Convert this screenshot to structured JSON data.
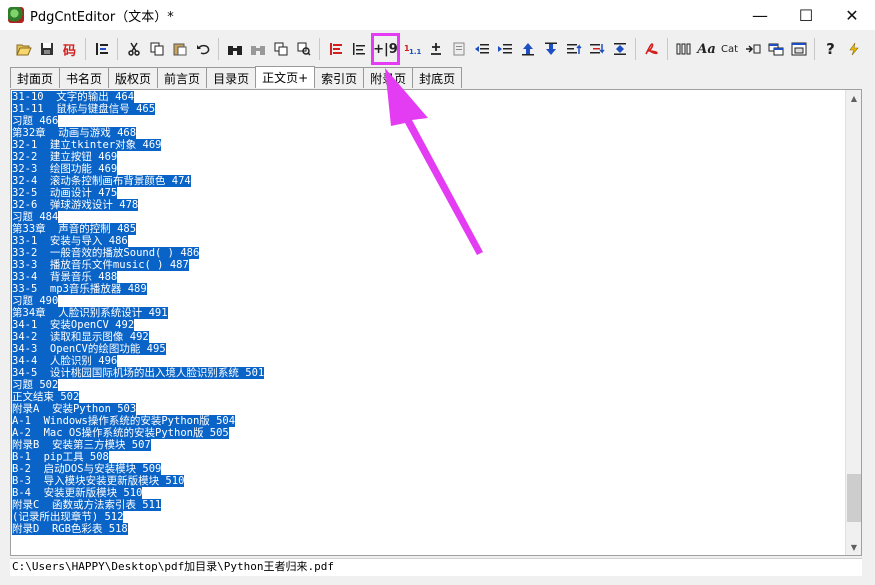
{
  "window": {
    "title": "PdgCntEditor（文本）*",
    "min": "—",
    "max": "☐",
    "close": "✕"
  },
  "toolbar": {
    "icons": [
      "open-icon",
      "save-icon",
      "code-icon",
      "outline-icon",
      "cut-icon",
      "copy-icon",
      "paste-icon",
      "undo-icon",
      "find-icon",
      "find-next-icon",
      "replace-icon",
      "replace-all-icon",
      "align-left-icon",
      "level-icon",
      "add-page-number-icon",
      "renumber-icon",
      "plus-minus-icon",
      "document-icon",
      "indent-decrease-icon",
      "indent-increase-icon",
      "move-up-icon",
      "move-down-icon",
      "promote-icon",
      "demote-icon",
      "merge-icon",
      "pdf-icon",
      "book-icon",
      "font-icon",
      "cat-icon",
      "link-icon",
      "window-icon",
      "split-icon",
      "help-icon",
      "lightning-icon"
    ],
    "code_label": "码",
    "page_number_label": "+|9",
    "font_label": "Aa",
    "cat_label": "Cat",
    "help_label": "?"
  },
  "tabs": [
    {
      "label": "封面页",
      "active": false
    },
    {
      "label": "书名页",
      "active": false
    },
    {
      "label": "版权页",
      "active": false
    },
    {
      "label": "前言页",
      "active": false
    },
    {
      "label": "目录页",
      "active": false
    },
    {
      "label": "正文页+",
      "active": true
    },
    {
      "label": "索引页",
      "active": false
    },
    {
      "label": "附录页",
      "active": false
    },
    {
      "label": "封底页",
      "active": false
    }
  ],
  "editor": {
    "lines": [
      "31-10  文字的输出 464",
      "31-11  鼠标与键盘信号 465",
      "习题 466",
      "第32章  动画与游戏 468",
      "32-1  建立tkinter对象 469",
      "32-2  建立按钮 469",
      "32-3  绘图功能 469",
      "32-4  滚动条控制画布背景颜色 474",
      "32-5  动画设计 475",
      "32-6  弹球游戏设计 478",
      "习题 484",
      "第33章  声音的控制 485",
      "33-1  安装与导入 486",
      "33-2  一般音效的播放Sound( ) 486",
      "33-3  播放音乐文件music( ) 487",
      "33-4  背景音乐 488",
      "33-5  mp3音乐播放器 489",
      "习题 490",
      "第34章  人脸识别系统设计 491",
      "34-1  安装OpenCV 492",
      "34-2  读取和显示图像 492",
      "34-3  OpenCV的绘图功能 495",
      "34-4  人脸识别 496",
      "34-5  设计桃园国际机场的出入境人脸识别系统 501",
      "习题 502",
      "正文结束 502",
      "附录A  安装Python 503",
      "A-1  Windows操作系统的安装Python版 504",
      "A-2  Mac OS操作系统的安装Python版 505",
      "附录B  安装第三方模块 507",
      "B-1  pip工具 508",
      "B-2  启动DOS与安装模块 509",
      "B-3  导入模块安装更新版模块 510",
      "B-4  安装更新版模块 510",
      "附录C  函数或方法索引表 511",
      "(记录所出现章节) 512",
      "附录D  RGB色彩表 518"
    ]
  },
  "status": {
    "path": "C:\\Users\\HAPPY\\Desktop\\pdf加目录\\Python王者归来.pdf"
  },
  "colors": {
    "selection": "#0a64c8",
    "highlight": "#e33cf2"
  }
}
